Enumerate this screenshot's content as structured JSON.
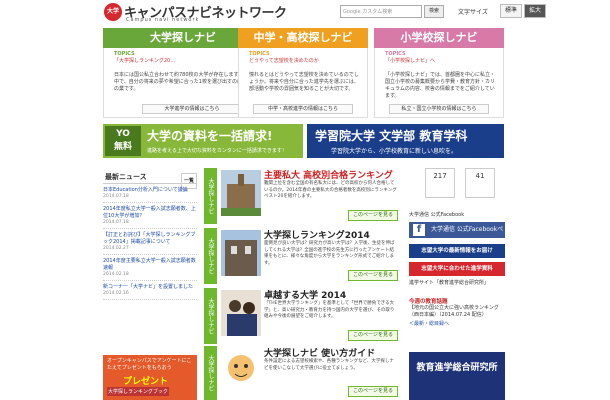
{
  "header": {
    "logo_badge": "大学",
    "logo_title": "キャンパスナビネットワーク",
    "logo_sub": "Campus navi network",
    "search_placeholder": "Google カスタム検索",
    "search_button": "検索",
    "font_size_label": "文字サイズ",
    "font_std": "標準",
    "font_large": "拡大"
  },
  "nav": [
    {
      "title": "大学探しナビ",
      "topics": "TOPICS",
      "topic_text": "「大学探しランキング20…",
      "desc": "日本には国公私立合わせて約780校の大学が存在します。その中で、自分の将来の夢や希望に合った1校を選び出すのは至難の業です。",
      "link": "大学進学の情報はこちら",
      "color": "#6aa73a"
    },
    {
      "title": "中学・高校探しナビ",
      "topics": "TOPICS",
      "topic_text": "どうやって志望校を決めたのか",
      "desc": "憧れるとはどうやって志望校を決めているのでしょうか。将来や自分に合った進学先を選ぶには、部活動や学校の雰囲気を知ることが大切です。",
      "link": "中学・高校進学の情報はこちら",
      "color": "#f0a020"
    },
    {
      "title": "小学校探しナビ",
      "topics": "TOPICS",
      "topic_text": "「小学校探しナビ」へ",
      "desc": "「小学校探しナビ」では、首都圏を中心に私立・国立小学校の募集概要から学費・教育方針・カリキュラムの内容、校舎の情報までをご紹介しています。",
      "link": "私立・国立小学校の情報はこちら",
      "color": "#d87aa8"
    }
  ],
  "banner_left": {
    "yo_line1": "YO",
    "yo_line2": "無料",
    "main": "大学の資料を一括請求!",
    "sub": "進路を考える上で大切な資料をカンタンに一括請求できます！"
  },
  "banner_right": {
    "main": "学習院大学 文学部 教育学科",
    "sub": "学習院大学から、小学校教育に新しい息吹を。"
  },
  "news": {
    "head": "最新ニュース",
    "more": "一覧",
    "items": [
      {
        "title": "日本Education分析入門について議論",
        "date": "2014.07.18"
      },
      {
        "title": "2014年度私立大学一般入試志願者数、上位10大学が増加？",
        "date": "2014.07.18"
      },
      {
        "title": "【訂正とお詫び】「大学探しランキングブック2014」掲載記事について",
        "date": "2014.02.27"
      },
      {
        "title": "2014年度主要私立大学一般入試志願者数速報",
        "date": "2014.02.18"
      },
      {
        "title": "新コーナー「大学ナビ」を設置しました",
        "date": "2014.02.16"
      }
    ]
  },
  "promo": {
    "top": "オープンキャンパスでアンケートにこたえてプレゼントをもらおう",
    "big": "プレゼント",
    "cta": "大学探しランキングブック"
  },
  "features": [
    {
      "side": "大学探しナビ",
      "title": "主要私大 高校別合格ランキング",
      "body": "難関上位を含む全国の有名私大には、どの高校から何人合格しているのか。2014年春の主要私大の合格者数を高校別にランキング ベスト20を紹介します。",
      "button": "このページを見る",
      "title_color": "#c22"
    },
    {
      "side": "大学探しナビ",
      "title": "大学探しランキング2014",
      "body": "面倒見が良い大学は？研究力が高い大学は？入学後、生徒を伸ばしてくれる大学は？全国の進学校の先生方に行ったアンケート結果をもとに、様々な角度から大学をランキング形式でご紹介します。",
      "button": "このページを見る",
      "title_color": "#222"
    },
    {
      "side": "大学探しナビ",
      "title": "卓越する大学 2014",
      "body": "「THE世界大学ランキング」を基準として「世界で勝負できる大学」と、高い研究力・教育力を持つ国内の大学を選び、その取り組みや今後の展望をご紹介します。",
      "button": "このページを見る",
      "title_color": "#222"
    },
    {
      "side": "大学探しナビ",
      "title": "大学探しナビ 使い方ガイド",
      "body": "条件設定による志望校検索や、各種ランキングなど、大学探しナビを使いこなして大学選びに役立てましょう。",
      "button": "このページを見る",
      "title_color": "#222"
    }
  ],
  "sidebar": {
    "count1": "217",
    "count2": "41",
    "follow": "大学通信 公式Facebook",
    "fb_label": "大学通信 公式Facebookページ",
    "bar1": "志望大学の最新情報をお届け",
    "bar2": "志望大学に合わせた進学資料",
    "exam": "進学サイト「教育進学総合研究所」",
    "pickup_head": "今週の教育話題",
    "pickup_text": "【地元の国公立大に強い高校ランキング（西日本編）（2014.07.24 配信）",
    "pickup_more": "＜最新・総目録へ",
    "school_img": "教育進学総合研究所"
  }
}
